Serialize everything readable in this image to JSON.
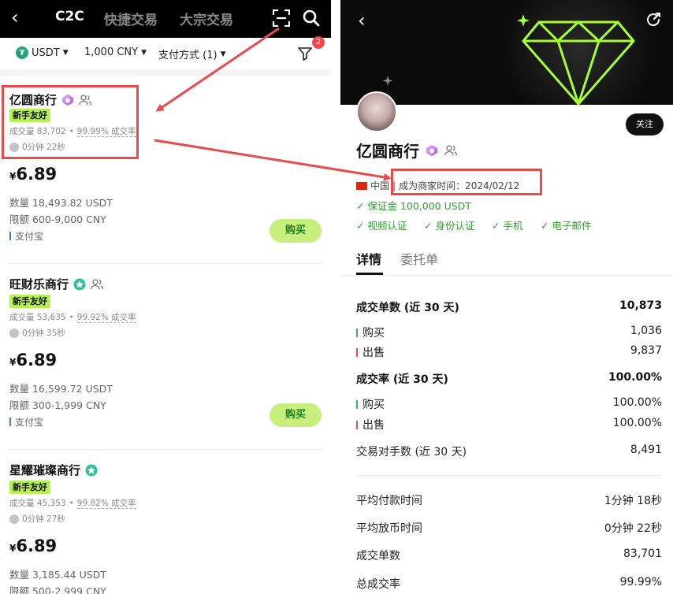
{
  "left": {
    "topbar": {
      "back_icon": "chevron-left-icon",
      "tabs": [
        "C2C",
        "快捷交易",
        "大宗交易"
      ],
      "scan_icon": "scan-icon",
      "search_icon": "search-icon"
    },
    "filters": {
      "coin": "USDT",
      "amount": "1,000 CNY",
      "payment": "支付方式 (1)",
      "filter_badge": "2"
    },
    "merchants": [
      {
        "name": "亿圆商行",
        "tag": "新手友好",
        "volume": "成交量 83,702",
        "rate": "99.99% 成交率",
        "time": "0分钟 22秒",
        "currency": "¥",
        "price": "6.89",
        "quantity": "数量 18,493.82 USDT",
        "limit": "限额 600-9,000 CNY",
        "payment": "支付宝",
        "buy": "购买"
      },
      {
        "name": "旺财乐商行",
        "tag": "新手友好",
        "volume": "成交量 53,635",
        "rate": "99.92% 成交率",
        "time": "0分钟 35秒",
        "currency": "¥",
        "price": "6.89",
        "quantity": "数量 16,599.72 USDT",
        "limit": "限额 300-1,999 CNY",
        "payment": "支付宝",
        "buy": "购买"
      },
      {
        "name": "星耀璀璨商行",
        "tag": "新手友好",
        "volume": "成交量 45,353",
        "rate": "99.82% 成交率",
        "time": "0分钟 27秒",
        "currency": "¥",
        "price": "6.89",
        "quantity": "数量 3,185.44 USDT",
        "limit": "限额 500-2,999 CNY",
        "payment": "",
        "buy": ""
      }
    ]
  },
  "right": {
    "follow": "关注",
    "name": "亿圆商行",
    "country": "中国",
    "merchant_since": "成为商家时间：2024/02/12",
    "deposit": "✓ 保证金 100,000 USDT",
    "verifications": [
      "✓ 视频认证",
      "✓ 身份认证",
      "✓ 手机",
      "✓ 电子邮件"
    ],
    "tabs": [
      "详情",
      "委托单"
    ],
    "stats": [
      {
        "label": "成交单数 (近 30 天)",
        "value": "10,873",
        "bold": true
      },
      {
        "label": "购买",
        "value": "1,036",
        "bar": "buy"
      },
      {
        "label": "出售",
        "value": "9,837",
        "bar": "sell"
      },
      {
        "label": "成交率 (近 30 天)",
        "value": "100.00%",
        "bold": true
      },
      {
        "label": "购买",
        "value": "100.00%",
        "bar": "buy"
      },
      {
        "label": "出售",
        "value": "100.00%",
        "bar": "sell"
      },
      {
        "label": "交易对手数 (近 30 天)",
        "value": "8,491"
      }
    ],
    "stats2": [
      {
        "label": "平均付款时间",
        "value": "1分钟 18秒"
      },
      {
        "label": "平均放币时间",
        "value": "0分钟 22秒"
      },
      {
        "label": "成交单数",
        "value": "83,701"
      },
      {
        "label": "总成交率",
        "value": "99.99%"
      }
    ]
  },
  "colors": {
    "accent_green": "#b6f154",
    "buy_button": "#c6ef7e",
    "highlight_red": "#e84b4b",
    "verify_green": "#2aa52a"
  }
}
